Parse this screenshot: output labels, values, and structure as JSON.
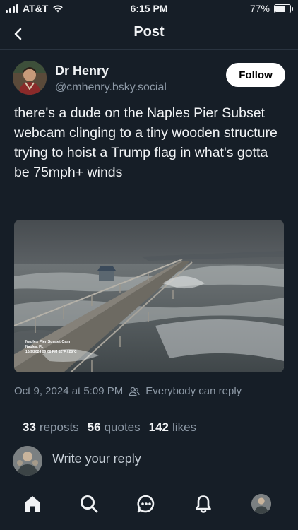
{
  "status_bar": {
    "carrier": "AT&T",
    "time": "6:15 PM",
    "battery_percent": "77%",
    "battery_level": 0.77
  },
  "nav": {
    "title": "Post",
    "back_icon": "chevron-left-icon"
  },
  "post": {
    "author_name": "Dr Henry",
    "author_handle": "@cmhenry.bsky.social",
    "follow_label": "Follow",
    "text": "there's a dude on the Naples Pier Subset webcam clinging to a tiny wooden structure trying to hoist a Trump flag in what's gotta be 75mph+ winds",
    "media": {
      "overlay_title": "Naples Pier Sunset Cam",
      "overlay_location": "Naples, FL",
      "overlay_info": "10/9/2024  06:08 PM  82°F / 28°C"
    },
    "timestamp": "Oct 9, 2024 at 5:09 PM",
    "reply_setting": "Everybody can reply",
    "stats": {
      "reposts_count": "33",
      "reposts_label": "reposts",
      "quotes_count": "56",
      "quotes_label": "quotes",
      "likes_count": "142",
      "likes_label": "likes"
    }
  },
  "reply": {
    "placeholder": "Write your reply"
  },
  "tabbar": {
    "items": [
      "home-icon",
      "search-icon",
      "chat-icon",
      "bell-icon",
      "profile-avatar"
    ]
  },
  "colors": {
    "background": "#161e27",
    "text": "#f1f3f5",
    "muted": "#8e9aa7",
    "divider": "#2a3440",
    "follow_bg": "#ffffff"
  }
}
